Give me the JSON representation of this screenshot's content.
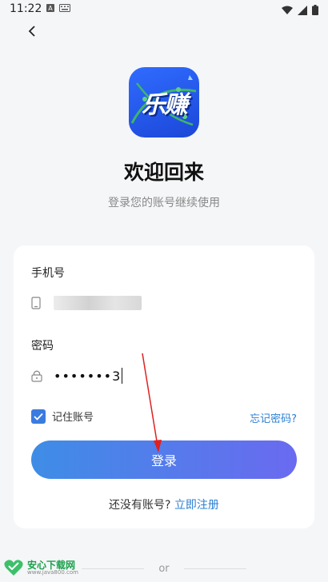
{
  "status_bar": {
    "time": "11:22",
    "notification_icons": [
      "text-icon",
      "keyboard-icon"
    ],
    "right_icons": [
      "wifi-icon",
      "signal-icon",
      "battery-icon"
    ]
  },
  "header": {
    "back_icon": "chevron-left-icon"
  },
  "app": {
    "logo_text": "乐赚",
    "title": "欢迎回来",
    "subtitle": "登录您的账号继续使用"
  },
  "form": {
    "phone_label": "手机号",
    "phone_value": "",
    "password_label": "密码",
    "password_value": "•••••••3",
    "remember_label": "记住账号",
    "remember_checked": true,
    "forgot_label": "忘记密码?",
    "login_label": "登录",
    "register_question": "还没有账号? ",
    "register_link": "立即注册"
  },
  "divider": {
    "text": "or"
  },
  "watermark": {
    "main": "安心下载网",
    "sub": "www.java800.com"
  },
  "colors": {
    "accent": "#2b7fd4",
    "button_start": "#3e8de6",
    "button_end": "#6a6af0",
    "checkbox": "#3a7be0",
    "annotation_arrow": "#e02020"
  }
}
